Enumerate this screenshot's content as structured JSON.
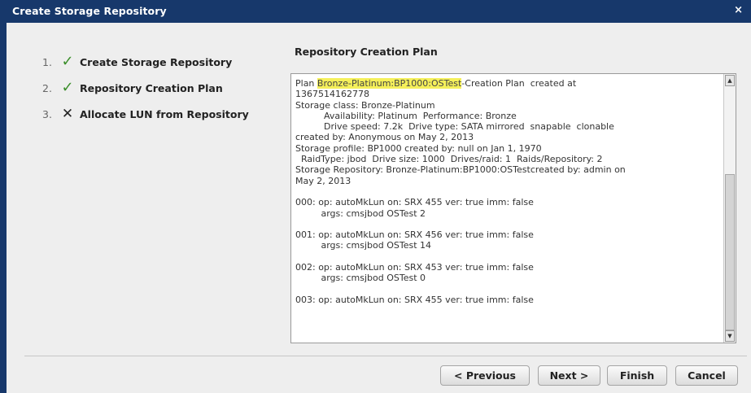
{
  "window": {
    "title": "Create Storage Repository",
    "close_label": "×"
  },
  "steps": [
    {
      "num": "1.",
      "status": "✓",
      "label": "Create Storage Repository"
    },
    {
      "num": "2.",
      "status": "✓",
      "label": "Repository Creation Plan"
    },
    {
      "num": "3.",
      "status": "✕",
      "label": "Allocate LUN from Repository"
    }
  ],
  "plan": {
    "heading": "Repository Creation Plan",
    "prefix": "Plan ",
    "highlight": "Bronze-Platinum:BP1000:OSTest",
    "body": "-Creation Plan  created at\n1367514162778\nStorage class: Bronze-Platinum\n          Availability: Platinum  Performance: Bronze\n          Drive speed: 7.2k  Drive type: SATA mirrored  snapable  clonable\ncreated by: Anonymous on May 2, 2013\nStorage profile: BP1000 created by: null on Jan 1, 1970\n  RaidType: jbod  Drive size: 1000  Drives/raid: 1  Raids/Repository: 2\nStorage Repository: Bronze-Platinum:BP1000:OSTestcreated by: admin on\nMay 2, 2013\n\n000: op: autoMkLun on: SRX 455 ver: true imm: false\n         args: cmsjbod OSTest 2\n\n001: op: autoMkLun on: SRX 456 ver: true imm: false\n         args: cmsjbod OSTest 14\n\n002: op: autoMkLun on: SRX 453 ver: true imm: false\n         args: cmsjbod OSTest 0\n\n003: op: autoMkLun on: SRX 455 ver: true imm: false"
  },
  "scrollbar": {
    "up": "▲",
    "down": "▼"
  },
  "buttons": {
    "previous": "< Previous",
    "next": "Next >",
    "finish": "Finish",
    "cancel": "Cancel"
  }
}
